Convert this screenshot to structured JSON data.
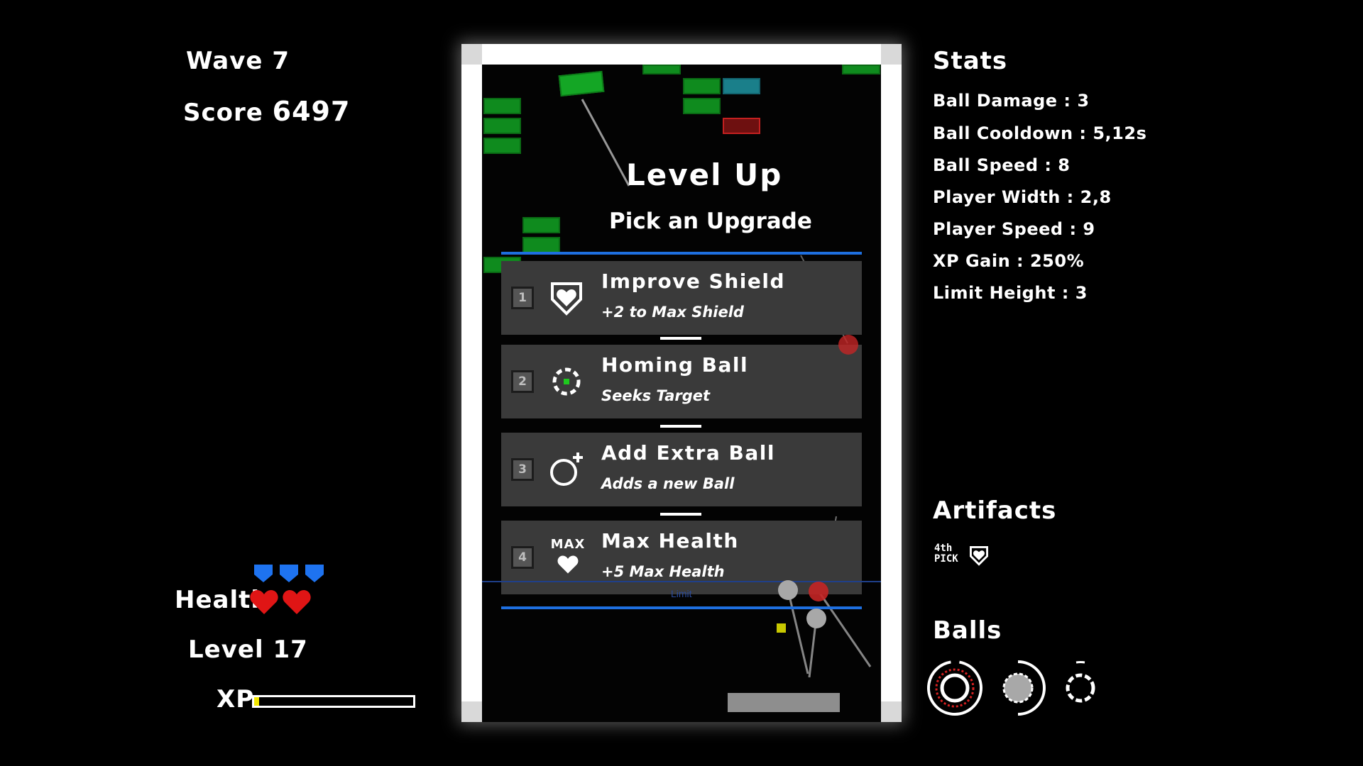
{
  "hud": {
    "wave_label": "Wave",
    "wave_value": "7",
    "score_label": "Score",
    "score_value": "6497",
    "health_label": "Health",
    "level_label": "Level",
    "level_value": "17",
    "xp_label": "XP",
    "xp_progress": 0.03,
    "shield_count": 3,
    "heart_count": 2
  },
  "level_up": {
    "title": "Level Up",
    "subtitle": "Pick an Upgrade",
    "limit_label": "Limit",
    "options": [
      {
        "number": "1",
        "title": "Improve Shield",
        "description": "+2 to Max Shield",
        "icon": "shield-heart-icon"
      },
      {
        "number": "2",
        "title": "Homing Ball",
        "description": "Seeks Target",
        "icon": "target-ball-icon"
      },
      {
        "number": "3",
        "title": "Add Extra Ball",
        "description": "Adds a new Ball",
        "icon": "ball-plus-icon"
      },
      {
        "number": "4",
        "title": "Max Health",
        "description": "+5 Max Health",
        "icon": "max-heart-icon",
        "icon_text": "MAX"
      }
    ]
  },
  "stats": {
    "title": "Stats",
    "lines": [
      "Ball Damage : 3",
      "Ball Cooldown : 5,12s",
      "Ball Speed : 8",
      "Player Width : 2,8",
      "Player Speed : 9",
      "XP Gain : 250%",
      "Limit Height : 3"
    ]
  },
  "artifacts": {
    "title": "Artifacts",
    "items": [
      {
        "icon": "fourth-pick-icon",
        "text_line1": "4th",
        "text_line2": "PICK"
      },
      {
        "icon": "shield-heart-icon"
      }
    ]
  },
  "balls": {
    "title": "Balls",
    "items": [
      {
        "icon": "red-ring-ball-icon",
        "cooldown": 0.95
      },
      {
        "icon": "grey-ball-icon",
        "cooldown": 0.5
      },
      {
        "icon": "white-ring-ball-icon",
        "cooldown": 0.1
      }
    ]
  },
  "colors": {
    "shield": "#1e73f0",
    "heart": "#e01515",
    "brick": "#0f8b1e",
    "brick_teal": "#1a7f8a",
    "brick_red": "#6e1010",
    "accent_line": "#1e6fe0",
    "xp_fill": "#f2e600",
    "card_bg": "#3a3a3a"
  }
}
